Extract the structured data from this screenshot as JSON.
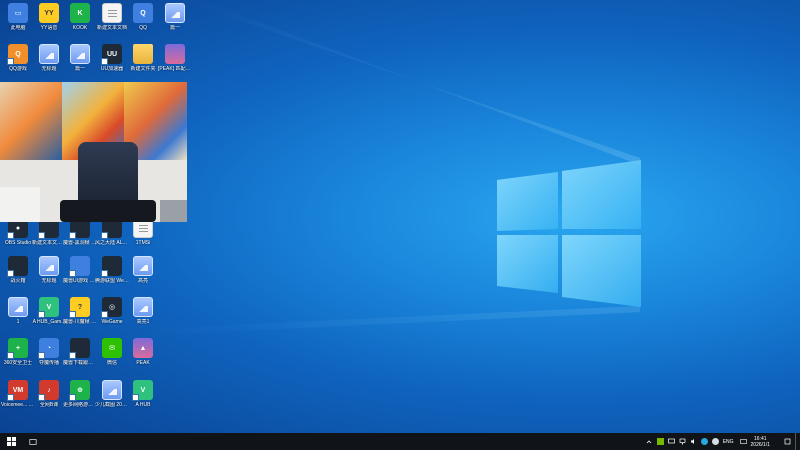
{
  "desktop": {
    "icons": [
      {
        "label": "此电脑",
        "tile": "t-blue",
        "glyph": "▭",
        "shortcut": false
      },
      {
        "label": "YY语音",
        "tile": "t-yellow",
        "glyph": "YY",
        "shortcut": false
      },
      {
        "label": "KOOK",
        "tile": "t-green",
        "glyph": "K",
        "shortcut": false
      },
      {
        "label": "新建文本文档",
        "tile": "t-doc",
        "glyph": "",
        "shortcut": false
      },
      {
        "label": "QQ",
        "tile": "t-blue",
        "glyph": "Q",
        "shortcut": false
      },
      {
        "label": "篇一",
        "tile": "t-pic",
        "glyph": "",
        "shortcut": false
      },
      {
        "label": "QQ游戏",
        "tile": "t-orange",
        "glyph": "Q",
        "shortcut": true
      },
      {
        "label": "无标题",
        "tile": "t-pic",
        "glyph": "",
        "shortcut": false
      },
      {
        "label": "篇一",
        "tile": "t-pic",
        "glyph": "",
        "shortcut": false
      },
      {
        "label": "UU加速器",
        "tile": "t-dark",
        "glyph": "UU",
        "shortcut": true
      },
      {
        "label": "新建文件夹",
        "tile": "t-folder",
        "glyph": "",
        "shortcut": false
      },
      {
        "label": "[PEAK] 匹配不上4 (2)",
        "tile": "t-peak",
        "glyph": "",
        "shortcut": false
      },
      {
        "label": "OBS Studio",
        "tile": "t-dark",
        "glyph": "●",
        "shortcut": true
      },
      {
        "label": "新建文本文档 (4)",
        "tile": "t-dark",
        "glyph": "",
        "shortcut": true
      },
      {
        "label": "魔兽-黑洞帧 画面",
        "tile": "t-dark",
        "glyph": "",
        "shortcut": true
      },
      {
        "label": "风之大陆 ALTUBR...",
        "tile": "t-dark",
        "glyph": "",
        "shortcut": true
      },
      {
        "label": "1TMSi",
        "tile": "t-doc",
        "glyph": "",
        "shortcut": false
      },
      {
        "label": "战火箱",
        "tile": "t-dark",
        "glyph": "",
        "shortcut": true
      },
      {
        "label": "无标题",
        "tile": "t-pic",
        "glyph": "",
        "shortcut": false
      },
      {
        "label": "魔兽UI游戏 机控制平台",
        "tile": "t-blue",
        "glyph": "",
        "shortcut": true
      },
      {
        "label": "腾游联盟 WeGame版",
        "tile": "t-dark",
        "glyph": "",
        "shortcut": true
      },
      {
        "label": "高亮",
        "tile": "t-pic",
        "glyph": "",
        "shortcut": false
      },
      {
        "label": "1",
        "tile": "t-pic",
        "glyph": "",
        "shortcut": false
      },
      {
        "label": "A HUB_Gam...",
        "tile": "t-vmoo",
        "glyph": "V",
        "shortcut": true
      },
      {
        "label": "魔兽-川魔帧 读文本",
        "tile": "t-yellow",
        "glyph": "?",
        "shortcut": true
      },
      {
        "label": "WeGame",
        "tile": "t-dark",
        "glyph": "◎",
        "shortcut": true
      },
      {
        "label": "高亮1",
        "tile": "t-pic",
        "glyph": "",
        "shortcut": false
      },
      {
        "label": "360安全卫士",
        "tile": "t-green",
        "glyph": "+",
        "shortcut": true
      },
      {
        "label": "夺魔传播",
        "tile": "t-blue",
        "glyph": "◔",
        "shortcut": true
      },
      {
        "label": "魔兽下载跟踪 设置",
        "tile": "t-dark",
        "glyph": "",
        "shortcut": true
      },
      {
        "label": "微信",
        "tile": "t-wechat",
        "glyph": "✉",
        "shortcut": false
      },
      {
        "label": "PEAK",
        "tile": "t-peak",
        "glyph": "▲",
        "shortcut": false
      },
      {
        "label": "Voicemee... Banana",
        "tile": "t-red",
        "glyph": "VM",
        "shortcut": true
      },
      {
        "label": "全网B课",
        "tile": "t-red",
        "glyph": "♪",
        "shortcut": true
      },
      {
        "label": "更多网络游戏 下载",
        "tile": "t-green",
        "glyph": "⊕",
        "shortcut": true
      },
      {
        "label": "少儿截图 20241125...",
        "tile": "t-pic",
        "glyph": "",
        "shortcut": false
      },
      {
        "label": "A HUB",
        "tile": "t-vmoo",
        "glyph": "V",
        "shortcut": true
      }
    ]
  },
  "taskbar": {
    "tray": {
      "lang": "ENG",
      "time": "16:41",
      "date": "2026/1/1"
    }
  },
  "colors": {
    "taskbar": "#101418",
    "accent": "#1a86db"
  }
}
